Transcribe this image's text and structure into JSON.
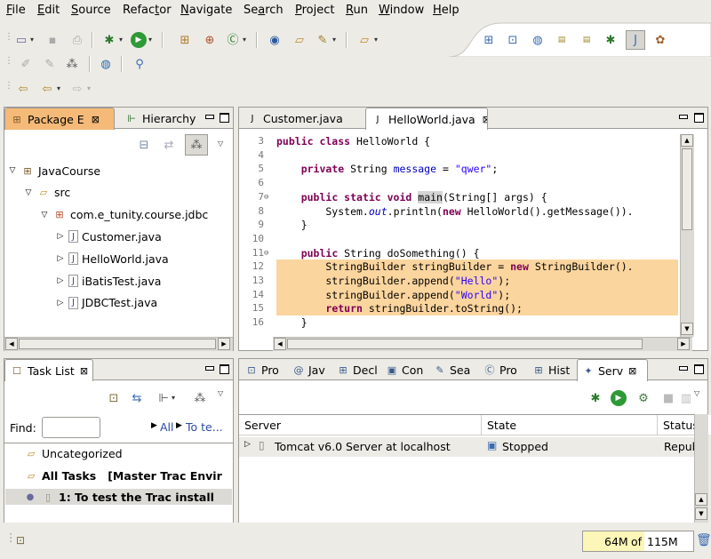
{
  "menu": [
    "File",
    "Edit",
    "Source",
    "Refactor",
    "Navigate",
    "Search",
    "Project",
    "Run",
    "Window",
    "Help"
  ],
  "menu_mnemonic": [
    "F",
    "E",
    "S",
    "t",
    "N",
    "a",
    "P",
    "R",
    "W",
    "H"
  ],
  "package_explorer": {
    "tabs": [
      "Package E",
      "Hierarchy"
    ],
    "tree": [
      {
        "label": "JavaCourse",
        "level": 0,
        "twisty": "▽",
        "icon": "project-icon"
      },
      {
        "label": "src",
        "level": 1,
        "twisty": "▽",
        "icon": "source-folder-icon"
      },
      {
        "label": "com.e_tunity.course.jdbc",
        "level": 2,
        "twisty": "▽",
        "icon": "package-icon"
      },
      {
        "label": "Customer.java",
        "level": 3,
        "twisty": "▷",
        "icon": "java-file-icon"
      },
      {
        "label": "HelloWorld.java",
        "level": 3,
        "twisty": "▷",
        "icon": "java-file-icon"
      },
      {
        "label": "iBatisTest.java",
        "level": 3,
        "twisty": "▷",
        "icon": "java-file-icon"
      },
      {
        "label": "JDBCTest.java",
        "level": 3,
        "twisty": "▷",
        "icon": "java-file-icon"
      }
    ]
  },
  "editor": {
    "tabs": [
      "Customer.java",
      "HelloWorld.java"
    ],
    "lines": [
      {
        "no": "3",
        "html": "<span class='kw'>public class</span> HelloWorld {",
        "hl": false,
        "fold": ""
      },
      {
        "no": "4",
        "html": "",
        "hl": false,
        "fold": ""
      },
      {
        "no": "5",
        "html": "    <span class='kw'>private</span> String <span class='fld'>message</span> = <span class='str'>\"qwer\"</span>;",
        "hl": false,
        "fold": ""
      },
      {
        "no": "6",
        "html": "",
        "hl": false,
        "fold": ""
      },
      {
        "no": "7",
        "html": "    <span class='kw'>public static void</span> <span style='background:#d4d4d4'>main</span>(String[] args) {",
        "hl": false,
        "fold": "⊖"
      },
      {
        "no": "8",
        "html": "        System.<span class='it'>out</span>.println(<span class='kw'>new</span> HelloWorld().getMessage()).",
        "hl": false,
        "fold": ""
      },
      {
        "no": "9",
        "html": "    }",
        "hl": false,
        "fold": ""
      },
      {
        "no": "10",
        "html": "",
        "hl": false,
        "fold": ""
      },
      {
        "no": "11",
        "html": "    <span class='kw'>public</span> String doSomething() {",
        "hl": false,
        "fold": "⊖"
      },
      {
        "no": "12",
        "html": "        StringBuilder stringBuilder = <span class='kw'>new</span> StringBuilder().",
        "hl": true,
        "fold": ""
      },
      {
        "no": "13",
        "html": "        stringBuilder.append(<span class='str'>\"Hello\"</span>);",
        "hl": true,
        "fold": ""
      },
      {
        "no": "14",
        "html": "        stringBuilder.append(<span class='str'>\"World\"</span>);",
        "hl": true,
        "fold": ""
      },
      {
        "no": "15",
        "html": "        <span class='kw'>return</span> stringBuilder.toString();",
        "hl": true,
        "fold": ""
      },
      {
        "no": "16",
        "html": "    }",
        "hl": false,
        "fold": ""
      }
    ]
  },
  "task_list": {
    "tab": "Task List",
    "find_label": "Find:",
    "find_value": "",
    "filter_all": "All",
    "filter_to": "To te...",
    "rows": [
      {
        "label": "Uncategorized",
        "bold": false
      },
      {
        "label": "All Tasks   [Master Trac Envir",
        "bold": true
      },
      {
        "label": "1: To test the Trac install",
        "bold": true
      }
    ]
  },
  "bottom_tabs": [
    "Pro",
    "Jav",
    "Decl",
    "Con",
    "Sea",
    "Pro",
    "Hist",
    "Serv"
  ],
  "servers": {
    "columns": [
      "Server",
      "State",
      "Status"
    ],
    "rows": [
      {
        "server": "Tomcat v6.0 Server at localhost",
        "state": "Stopped",
        "status": "Republi"
      }
    ]
  },
  "status_bar": {
    "heap_used": "64M",
    "heap_of": "of",
    "heap_total": "115M",
    "heap_used_fraction": 0.56
  }
}
